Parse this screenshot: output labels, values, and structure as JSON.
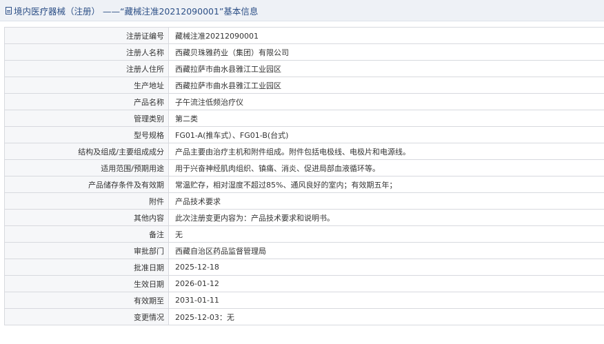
{
  "header": {
    "title": "境内医疗器械（注册） ——“藏械注准20212090001”基本信息",
    "icon": "document-icon"
  },
  "rows": [
    {
      "label": "注册证编号",
      "value": "藏械注准20212090001"
    },
    {
      "label": "注册人名称",
      "value": "西藏贝珠雅药业（集团）有限公司"
    },
    {
      "label": "注册人住所",
      "value": "西藏拉萨市曲水县雅江工业园区"
    },
    {
      "label": "生产地址",
      "value": "西藏拉萨市曲水县雅江工业园区"
    },
    {
      "label": "产品名称",
      "value": "子午流注低频治疗仪"
    },
    {
      "label": "管理类别",
      "value": "第二类"
    },
    {
      "label": "型号规格",
      "value": "FG01-A(推车式）、FG01-B(台式)"
    },
    {
      "label": "结构及组成/主要组成成分",
      "value": "产品主要由治疗主机和附件组成。附件包括电极线、电极片和电源线。"
    },
    {
      "label": "适用范围/预期用途",
      "value": "用于兴奋神经肌肉组织、镇痛、消炎、促进局部血液循环等。"
    },
    {
      "label": "产品储存条件及有效期",
      "value": "常温贮存，相对湿度不超过85%、通风良好的室内；有效期五年；"
    },
    {
      "label": "附件",
      "value": "产品技术要求"
    },
    {
      "label": "其他内容",
      "value": "此次注册变更内容为：产品技术要求和说明书。"
    },
    {
      "label": "备注",
      "value": "无"
    },
    {
      "label": "审批部门",
      "value": "西藏自治区药品监督管理局"
    },
    {
      "label": "批准日期",
      "value": "2025-12-18"
    },
    {
      "label": "生效日期",
      "value": "2026-01-12"
    },
    {
      "label": "有效期至",
      "value": "2031-01-11"
    },
    {
      "label": "变更情况",
      "value": "2025-12-03：无"
    }
  ]
}
